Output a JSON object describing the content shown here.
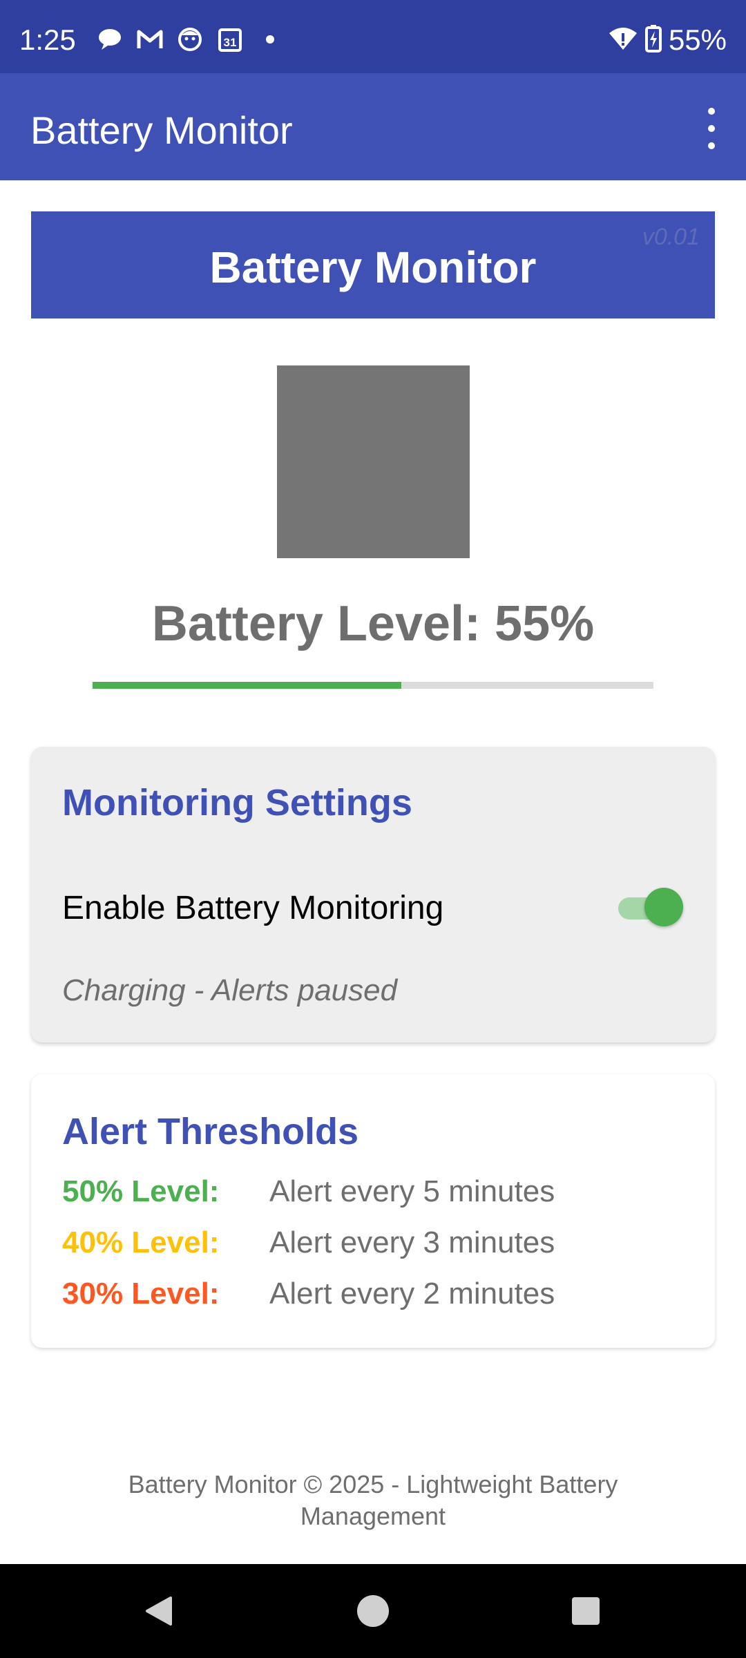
{
  "status_bar": {
    "time": "1:25",
    "battery_percent": "55%",
    "icons": [
      "chat-icon",
      "gmail-icon",
      "face-icon",
      "calendar-icon",
      "dot-icon"
    ],
    "calendar_day": "31"
  },
  "app_bar": {
    "title": "Battery Monitor"
  },
  "banner": {
    "title": "Battery Monitor",
    "version": "v0.01"
  },
  "battery": {
    "level_text": "Battery Level: 55%",
    "level_fraction": 0.55
  },
  "settings": {
    "title": "Monitoring Settings",
    "toggle_label": "Enable Battery Monitoring",
    "toggle_on": true,
    "status": "Charging - Alerts paused"
  },
  "thresholds": {
    "title": "Alert Thresholds",
    "rows": [
      {
        "level": "50% Level:",
        "text": "Alert every 5 minutes",
        "color": "#4caf50"
      },
      {
        "level": "40% Level:",
        "text": "Alert every 3 minutes",
        "color": "#ffc107"
      },
      {
        "level": "30% Level:",
        "text": "Alert every 2 minutes",
        "color": "#ff5722"
      }
    ]
  },
  "footer": {
    "text": "Battery Monitor © 2025 - Lightweight Battery Management"
  },
  "colors": {
    "primary": "#3f51b5",
    "status_bar": "#2f3f9f",
    "accent_green": "#4caf50"
  }
}
